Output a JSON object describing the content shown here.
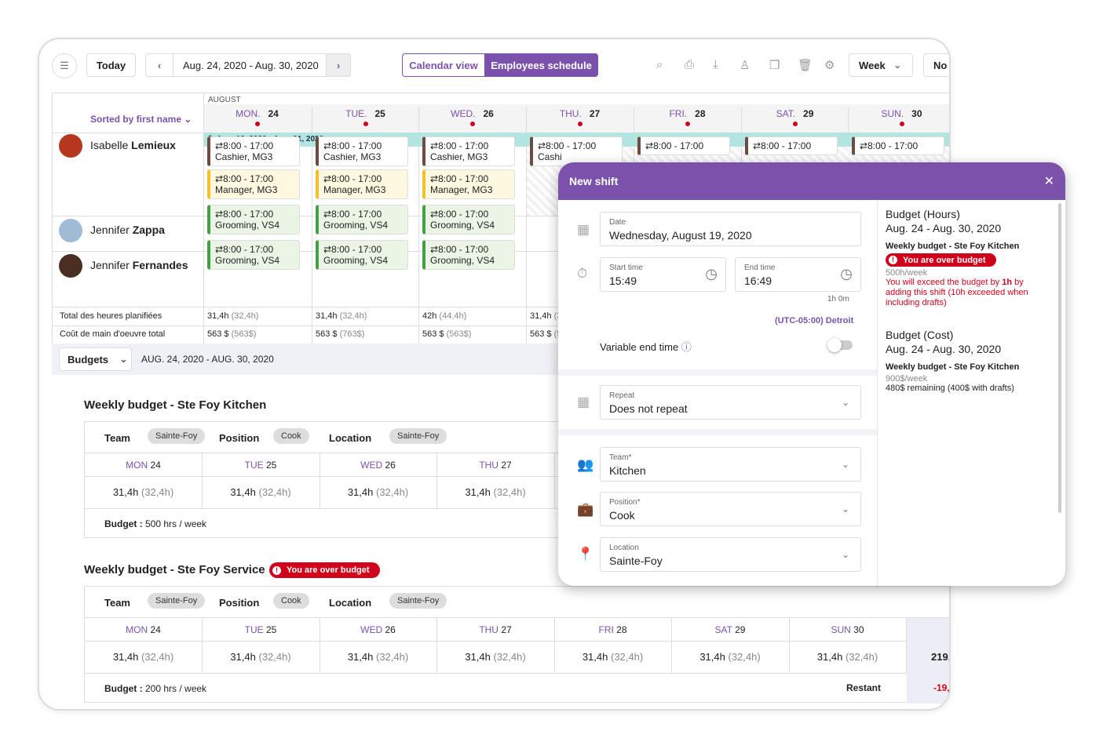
{
  "toolbar": {
    "today": "Today",
    "date_range": "Aug. 24, 2020 - Aug. 30, 2020",
    "calendar_view": "Calendar view",
    "employees_schedule": "Employees schedule",
    "week": "Week",
    "no": "No"
  },
  "calendar": {
    "month": "AUGUST",
    "sort_label": "Sorted by first name",
    "days": [
      {
        "name": "MON.",
        "num": "24"
      },
      {
        "name": "TUE.",
        "num": "25"
      },
      {
        "name": "WED.",
        "num": "26"
      },
      {
        "name": "THU.",
        "num": "27"
      },
      {
        "name": "FRI.",
        "num": "28"
      },
      {
        "name": "SAT.",
        "num": "29"
      },
      {
        "name": "SUN.",
        "num": "30"
      }
    ],
    "period_banner": "Aug. 19, 2020 - Aug. 31, 2020",
    "employees": [
      {
        "first": "Isabelle",
        "last": "Lemieux"
      },
      {
        "first": "Jennifer",
        "last": "Zappa"
      },
      {
        "first": "Jennifer",
        "last": "Fernandes"
      }
    ],
    "shift_time": "8:00 - 17:00",
    "cashier": "Cashier, MG3",
    "manager": "Manager, MG3",
    "grooming": "Grooming, VS4",
    "cashier_trunc": "Cashi",
    "total_hours_label": "Total des heures planifiées",
    "total_cost_label": "Coût de main d'oeuvre total",
    "hours": [
      {
        "v": "31,4h",
        "p": "(32,4h)"
      },
      {
        "v": "31,4h",
        "p": "(32,4h)"
      },
      {
        "v": "42h",
        "p": "(44,4h)"
      },
      {
        "v": "31,4h",
        "p": "(3"
      }
    ],
    "costs": [
      {
        "v": "563 $",
        "p": "(563$)"
      },
      {
        "v": "563 $",
        "p": "(763$)"
      },
      {
        "v": "563 $",
        "p": "(563$)"
      },
      {
        "v": "563 $",
        "p": "(5"
      }
    ]
  },
  "budgets": {
    "dropdown": "Budgets",
    "range": "AUG. 24, 2020 - AUG. 30, 2020",
    "kitchen": {
      "title": "Weekly budget - Ste Foy Kitchen",
      "budget_label": "Budget :",
      "budget_value": "500 hrs / week"
    },
    "service": {
      "title": "Weekly budget - Ste Foy Service",
      "over": "You are over budget",
      "budget_label": "Budget :",
      "budget_value": "200 hrs / week",
      "restant": "Restant",
      "total": "219,",
      "remaining": "-19,"
    },
    "filters": {
      "team_label": "Team",
      "team": "Sainte-Foy",
      "position_label": "Position",
      "position": "Cook",
      "location_label": "Location",
      "location": "Sainte-Foy"
    },
    "days": [
      {
        "d": "MON",
        "n": "24"
      },
      {
        "d": "TUE",
        "n": "25"
      },
      {
        "d": "WED",
        "n": "26"
      },
      {
        "d": "THU",
        "n": "27"
      },
      {
        "d": "FRI",
        "n": "28"
      },
      {
        "d": "SAT",
        "n": "29"
      },
      {
        "d": "SUN",
        "n": "30"
      }
    ],
    "value": "31,4h",
    "paren": "(32,4h)"
  },
  "dialog": {
    "title": "New shift",
    "date_label": "Date",
    "date": "Wednesday, August 19, 2020",
    "start_label": "Start time",
    "start": "15:49",
    "end_label": "End time",
    "end": "16:49",
    "duration": "1h 0m",
    "timezone": "(UTC-05:00) Detroit",
    "variable_end": "Variable end time",
    "repeat_label": "Repeat",
    "repeat": "Does not repeat",
    "team_label": "Team",
    "team": "Kitchen",
    "position_label": "Position",
    "position": "Cook",
    "location_label": "Location",
    "location": "Sainte-Foy",
    "side": {
      "hours_title": "Budget (Hours)",
      "hours_range": "Aug. 24 - Aug. 30, 2020",
      "kitchen": "Weekly budget - Ste Foy Kitchen",
      "over": "You are over budget",
      "per_week": "500h/week",
      "warn1": "You will exceed the budget by",
      "warn_bold": "1h",
      "warn2": "by adding this shift (10h exceeded when including drafts)",
      "cost_title": "Budget (Cost)",
      "cost_range": "Aug. 24 - Aug. 30, 2020",
      "cost_kitchen": "Weekly budget - Ste Foy Kitchen",
      "cost_per_week": "900$/week",
      "cost_remaining": "480$ remaining (400$ with drafts)"
    }
  }
}
